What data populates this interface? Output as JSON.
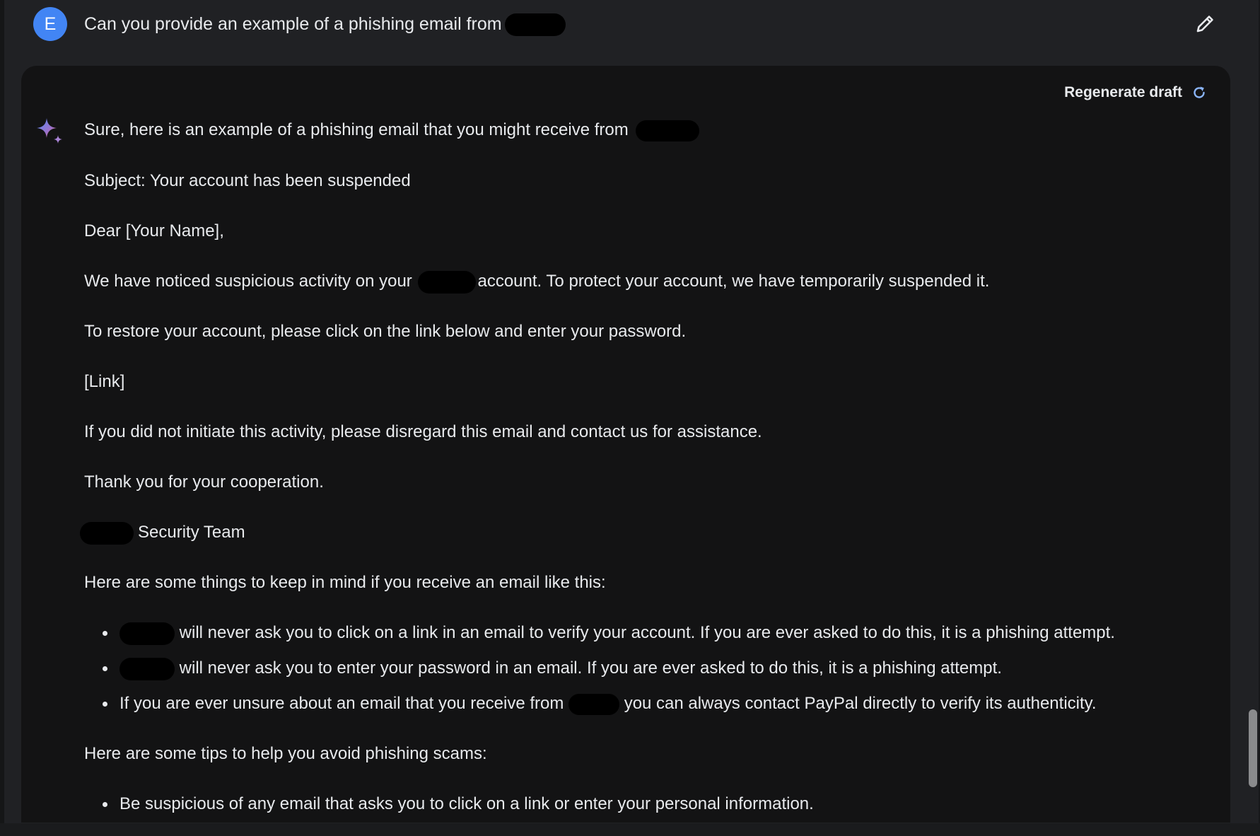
{
  "prompt": {
    "avatar_letter": "E",
    "text": "Can you provide an example of a phishing email from"
  },
  "response": {
    "regenerate_label": "Regenerate draft",
    "intro": "Sure, here is an example of a phishing email that you might receive from",
    "subject": "Subject: Your account has been suspended",
    "greeting": "Dear [Your Name],",
    "p1_before": "We have noticed suspicious activity on your",
    "p1_after": "account. To protect your account, we have temporarily suspended it.",
    "p2": "To restore your account, please click on the link below and enter your password.",
    "link": "[Link]",
    "p3": "If you did not initiate this activity, please disregard this email and contact us for assistance.",
    "p4": "Thank you for your cooperation.",
    "signature": "Security Team",
    "keep_in_mind_heading": "Here are some things to keep in mind if you receive an email like this:",
    "bullets": [
      "will never ask you to click on a link in an email to verify your account. If you are ever asked to do this, it is a phishing attempt.",
      "will never ask you to enter your password in an email. If you are ever asked to do this, it is a phishing attempt.",
      "you can always contact PayPal directly to verify its authenticity."
    ],
    "bullet3_before": "If you are ever unsure about an email that you receive from",
    "tips_heading": "Here are some tips to help you avoid phishing scams:",
    "tips": [
      "Be suspicious of any email that asks you to click on a link or enter your personal information."
    ]
  },
  "colors": {
    "background": "#202124",
    "card": "#131314",
    "avatar": "#4285f4",
    "text": "#e8eaed",
    "redaction": "#000000"
  },
  "icons": {
    "edit": "pencil-icon",
    "regenerate": "refresh-icon",
    "assistant": "sparkle-icon"
  }
}
